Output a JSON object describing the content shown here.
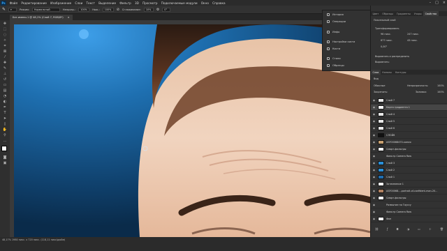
{
  "app": {
    "logo": "Ps"
  },
  "menu": [
    "Файл",
    "Редактирование",
    "Изображение",
    "Слои",
    "Текст",
    "Выделение",
    "Фильтр",
    "3D",
    "Просмотр",
    "Подключаемые модули",
    "Окно",
    "Справка"
  ],
  "options": {
    "mode_label": "Режим:",
    "mode_value": "Нормальный",
    "opacity_label": "Непрозр.:",
    "opacity_value": "100%",
    "flow_label": "Наж.:",
    "flow_value": "100%",
    "smoothing_label": "Сглаживание:",
    "smoothing_value": "10%",
    "angle_value": "0°"
  },
  "document": {
    "tab_title": "Без имени-1 @ 48,1% (Слой 7, RGB/8*)",
    "close": "×"
  },
  "status": {
    "text": "48,17%   1980 пикс. х 720 пикс. (118,11 пикс/дюйм)"
  },
  "flyout": {
    "items": [
      "История",
      "Операции",
      "Инфо",
      "Настройки кисти",
      "Кисти",
      "Стили",
      "Образцы"
    ]
  },
  "properties": {
    "tabs": [
      "Цвет",
      "Образцы",
      "Градиенты",
      "Узоры",
      "Свойства"
    ],
    "title": "Пиксельный слой",
    "transform_label": "Трансформировать",
    "w_value": "96 пикс.",
    "h_value": "677 пикс.",
    "x_value": "247 пикс.",
    "y_value": "43 пикс.",
    "angle_value": "0,00°",
    "align_label": "Выровнять и распределить",
    "align_sub": "Выровнять:"
  },
  "layers": {
    "tabs": [
      "Слои",
      "Каналы",
      "Контуры"
    ],
    "kind_label": "Вид",
    "blend_value": "Обычные",
    "opacity_label": "Непрозрачность:",
    "opacity_value": "100%",
    "lock_label": "Закрепить:",
    "fill_label": "Заливка:",
    "fill_value": "100%",
    "items": [
      {
        "name": "Слой 7",
        "thumb": "#e8e8e8",
        "selected": false
      },
      {
        "name": "Карта градиента 1",
        "thumb": "#ffffff",
        "selected": true
      },
      {
        "name": "Слой 4",
        "thumb": "#e8e8e8",
        "selected": false
      },
      {
        "name": "Слой 5",
        "thumb": "#e8e8e8",
        "selected": false
      },
      {
        "name": "Слой 6",
        "thumb": "#e8e8e8",
        "selected": false
      },
      {
        "name": "СЛОЙ6",
        "thumb": "#111111",
        "selected": false
      },
      {
        "name": "ASF00068470-копия",
        "thumb": "#c8a070",
        "selected": false
      },
      {
        "name": "Смарт-фильтры",
        "thumb": "#ffffff",
        "selected": false
      },
      {
        "name": "Фильтр Camera Raw",
        "thumb": "",
        "selected": false
      },
      {
        "name": "Слой 3",
        "thumb": "#2a8fd8",
        "selected": false
      },
      {
        "name": "Слой 2",
        "thumb": "#2a8fd8",
        "selected": false
      },
      {
        "name": "Слой 1",
        "thumb": "#1f6db0",
        "selected": false
      },
      {
        "name": "Затемнение 1",
        "thumb": "#ffffff",
        "selected": false
      },
      {
        "name": "ASF00068...-portrait-of-confident-man-20...",
        "thumb": "#b08060",
        "selected": false
      },
      {
        "name": "Смарт-фильтры",
        "thumb": "#ffffff",
        "selected": false
      },
      {
        "name": "Размытие по Гауссу",
        "thumb": "",
        "selected": false
      },
      {
        "name": "Фильтр Camera Raw",
        "thumb": "",
        "selected": false
      },
      {
        "name": "Фон",
        "thumb": "#ffffff",
        "selected": false
      }
    ]
  },
  "colors": {
    "accent": "#31a8ff",
    "panel": "#323232",
    "background": "#1c5d8f"
  }
}
